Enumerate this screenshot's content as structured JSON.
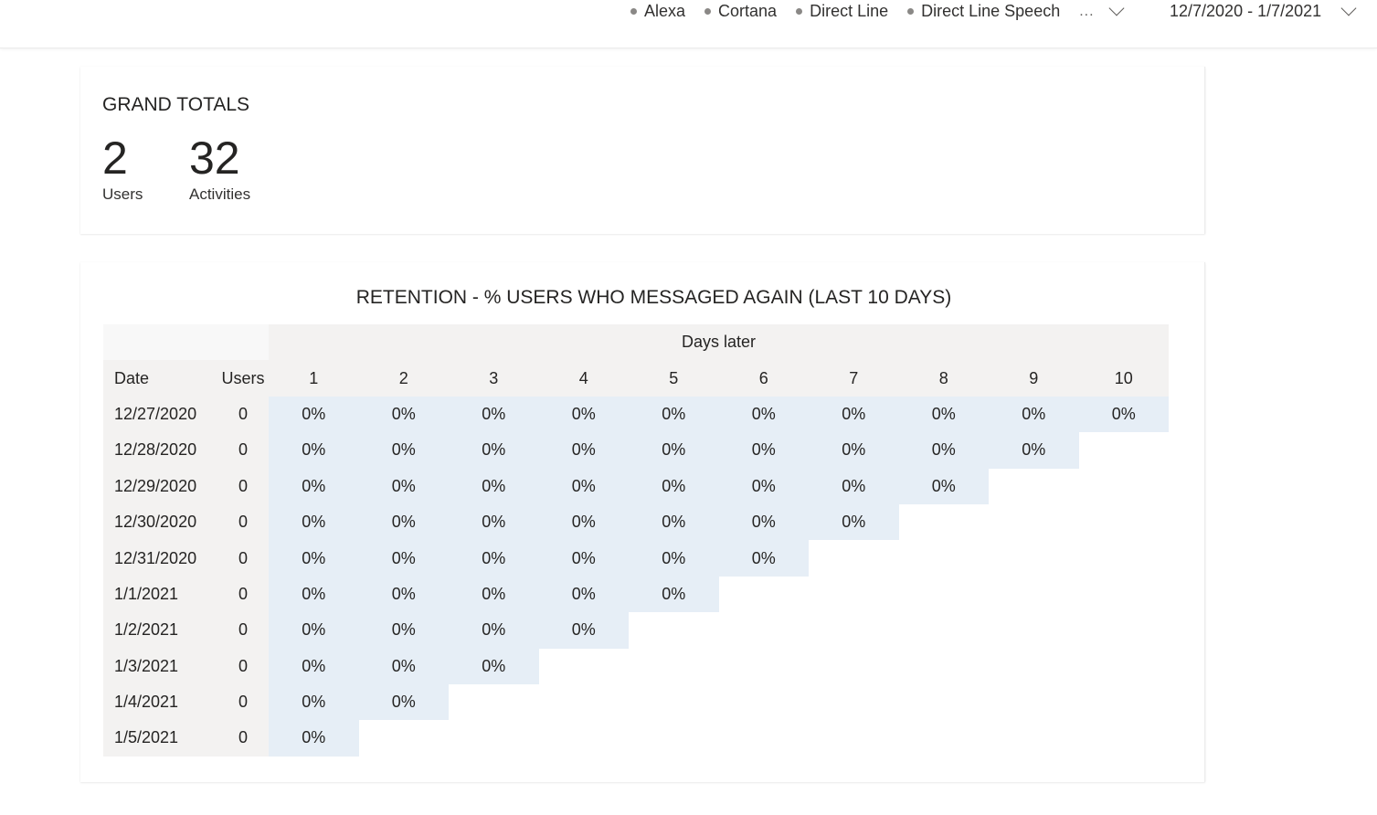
{
  "header": {
    "channels": [
      {
        "label": "Alexa"
      },
      {
        "label": "Cortana"
      },
      {
        "label": "Direct Line"
      },
      {
        "label": "Direct Line Speech"
      }
    ],
    "more_label": "...",
    "date_range": "12/7/2020 - 1/7/2021"
  },
  "grand_totals": {
    "title": "GRAND TOTALS",
    "users_value": "2",
    "users_label": "Users",
    "activities_value": "32",
    "activities_label": "Activities"
  },
  "retention": {
    "title": "RETENTION - % USERS WHO MESSAGED AGAIN (LAST 10 DAYS)",
    "days_later_label": "Days later",
    "date_header": "Date",
    "users_header": "Users",
    "day_headers": [
      "1",
      "2",
      "3",
      "4",
      "5",
      "6",
      "7",
      "8",
      "9",
      "10"
    ],
    "rows": [
      {
        "date": "12/27/2020",
        "users": "0",
        "values": [
          "0%",
          "0%",
          "0%",
          "0%",
          "0%",
          "0%",
          "0%",
          "0%",
          "0%",
          "0%"
        ]
      },
      {
        "date": "12/28/2020",
        "users": "0",
        "values": [
          "0%",
          "0%",
          "0%",
          "0%",
          "0%",
          "0%",
          "0%",
          "0%",
          "0%"
        ]
      },
      {
        "date": "12/29/2020",
        "users": "0",
        "values": [
          "0%",
          "0%",
          "0%",
          "0%",
          "0%",
          "0%",
          "0%",
          "0%"
        ]
      },
      {
        "date": "12/30/2020",
        "users": "0",
        "values": [
          "0%",
          "0%",
          "0%",
          "0%",
          "0%",
          "0%",
          "0%"
        ]
      },
      {
        "date": "12/31/2020",
        "users": "0",
        "values": [
          "0%",
          "0%",
          "0%",
          "0%",
          "0%",
          "0%"
        ]
      },
      {
        "date": "1/1/2021",
        "users": "0",
        "values": [
          "0%",
          "0%",
          "0%",
          "0%",
          "0%"
        ]
      },
      {
        "date": "1/2/2021",
        "users": "0",
        "values": [
          "0%",
          "0%",
          "0%",
          "0%"
        ]
      },
      {
        "date": "1/3/2021",
        "users": "0",
        "values": [
          "0%",
          "0%",
          "0%"
        ]
      },
      {
        "date": "1/4/2021",
        "users": "0",
        "values": [
          "0%",
          "0%"
        ]
      },
      {
        "date": "1/5/2021",
        "users": "0",
        "values": [
          "0%"
        ]
      }
    ]
  },
  "colors": {
    "filled_cell": "#e6eef6",
    "header_bg": "#f3f2f1"
  }
}
